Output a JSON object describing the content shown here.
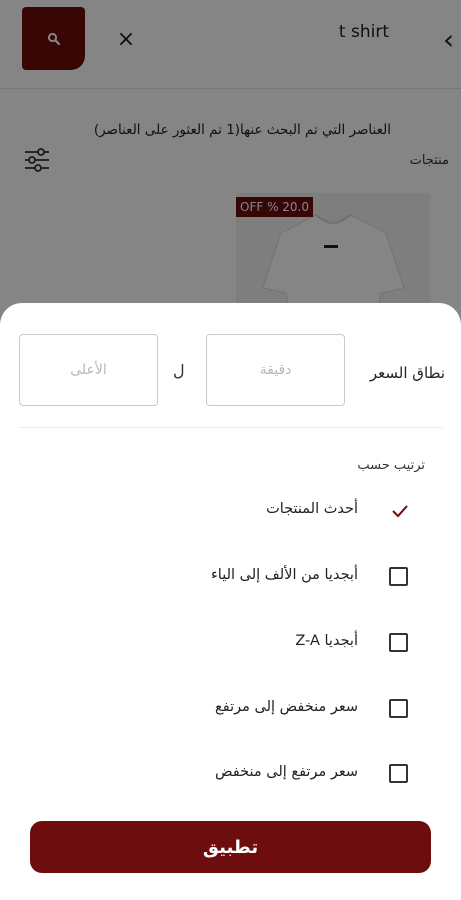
{
  "header": {
    "search_query": "t shirt",
    "clear_icon": "×",
    "back_icon": "‹"
  },
  "results": {
    "found_text": "العناصر التي تم البحث عنها(1 تم العثور على العناصر)",
    "products_label": "منتجات",
    "product": {
      "discount_badge": "OFF % 20.0"
    }
  },
  "filter_sheet": {
    "price_range_label": "نطاق السعر",
    "min_placeholder": "دقيقة",
    "to_label": "ل",
    "max_placeholder": "الأعلى",
    "sort_by_label": "ترتيب حسب",
    "sort_options": [
      {
        "label": "أحدث المنتجات",
        "selected": true
      },
      {
        "label": "أبجديا من الألف إلى الياء",
        "selected": false
      },
      {
        "label": "أبجديا Z-A",
        "selected": false
      },
      {
        "label": "سعر منخفض إلى مرتفع",
        "selected": false
      },
      {
        "label": "سعر مرتفع إلى منخفض",
        "selected": false
      }
    ],
    "apply_label": "تطبيق"
  },
  "colors": {
    "brand": "#6e0d0d",
    "overlay": "rgba(0,0,0,0.48)"
  }
}
